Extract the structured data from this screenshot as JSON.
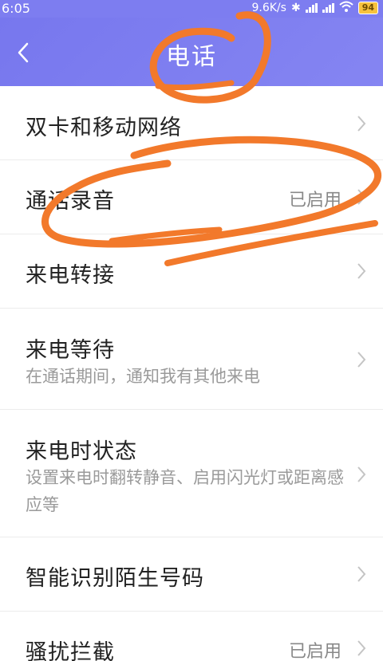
{
  "status_bar": {
    "time": "6:05",
    "network_speed": "9.6K/s",
    "battery": "94"
  },
  "header": {
    "title": "电话"
  },
  "settings": [
    {
      "label": "双卡和移动网络",
      "subtitle": "",
      "value": ""
    },
    {
      "label": "通话录音",
      "subtitle": "",
      "value": "已启用"
    },
    {
      "label": "来电转接",
      "subtitle": "",
      "value": ""
    },
    {
      "label": "来电等待",
      "subtitle": "在通话期间，通知我有其他来电",
      "value": ""
    },
    {
      "label": "来电时状态",
      "subtitle": "设置来电时翻转静音、启用闪光灯或距离感应等",
      "value": ""
    },
    {
      "label": "智能识别陌生号码",
      "subtitle": "",
      "value": ""
    },
    {
      "label": "骚扰拦截",
      "subtitle": "",
      "value": "已启用"
    }
  ],
  "colors": {
    "header_bg": "#7d7df0",
    "annotation": "#f2792b",
    "battery": "#f6c23e"
  }
}
